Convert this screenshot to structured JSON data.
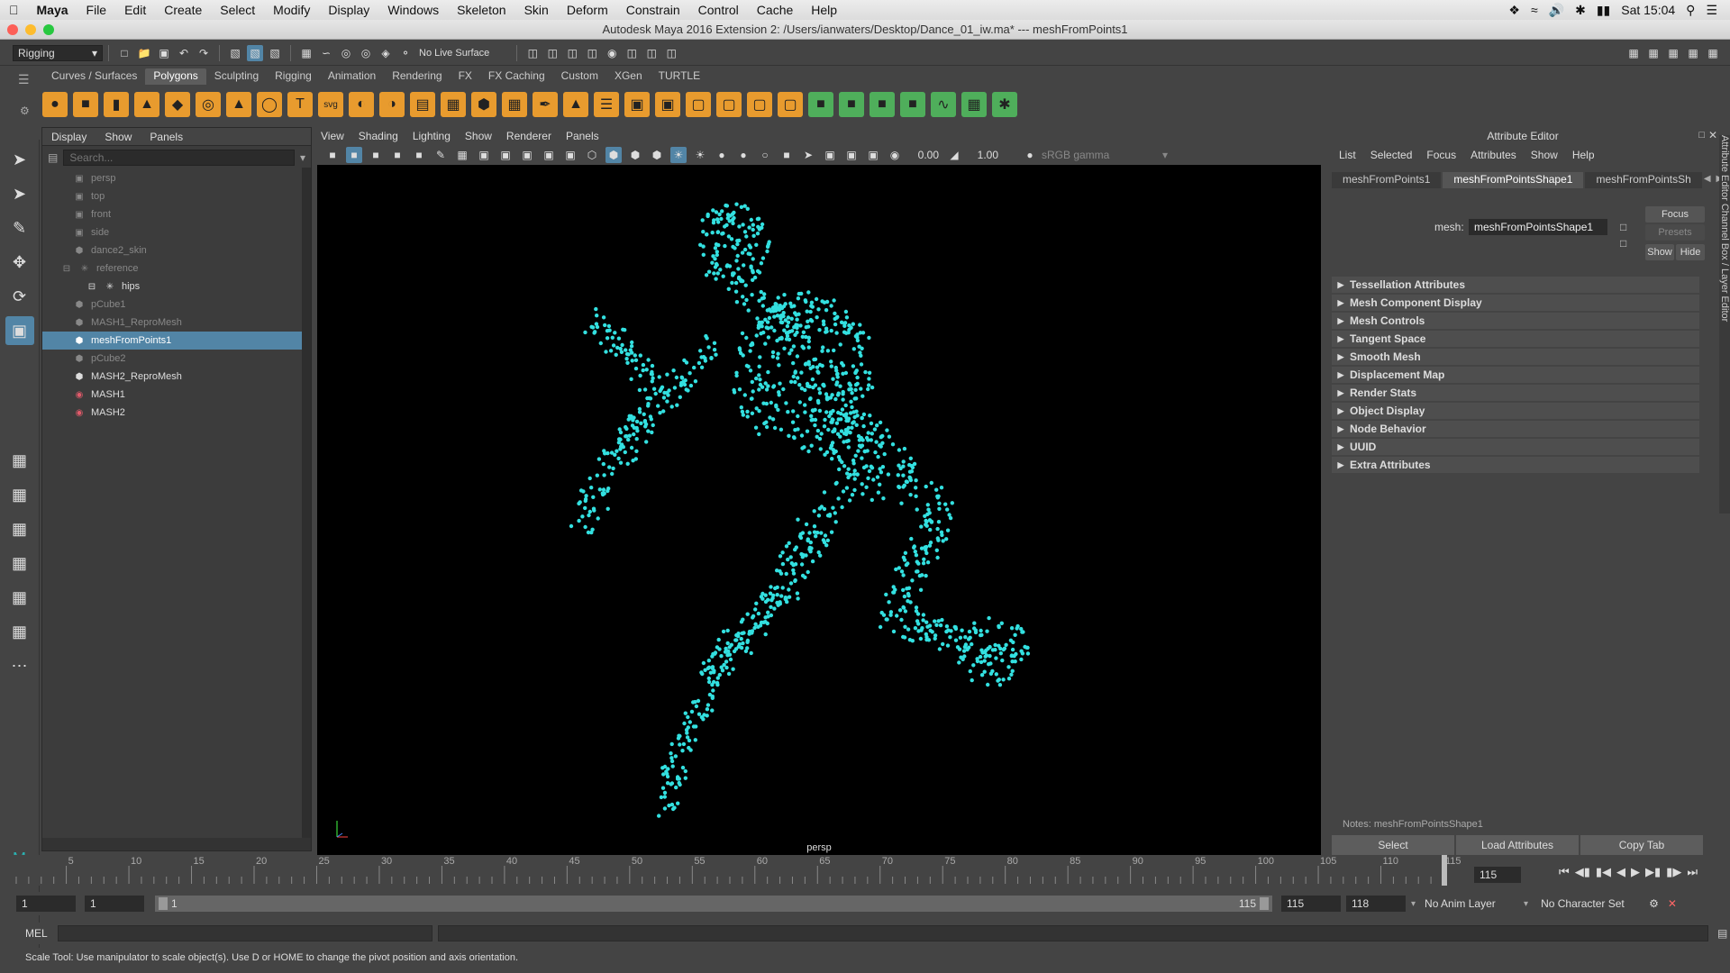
{
  "mac_menu": {
    "app_name": "Maya",
    "items": [
      "File",
      "Edit",
      "Create",
      "Select",
      "Modify",
      "Display",
      "Windows",
      "Skeleton",
      "Skin",
      "Deform",
      "Constrain",
      "Control",
      "Cache",
      "Help"
    ],
    "clock": "Sat 15:04"
  },
  "window_title": "Autodesk Maya 2016 Extension 2: /Users/ianwaters/Desktop/Dance_01_iw.ma*   ---   meshFromPoints1",
  "status_line": {
    "menu_set": "Rigging",
    "live_surface": "No Live Surface"
  },
  "shelf": {
    "tabs": [
      "Curves / Surfaces",
      "Polygons",
      "Sculpting",
      "Rigging",
      "Animation",
      "Rendering",
      "FX",
      "FX Caching",
      "Custom",
      "XGen",
      "TURTLE"
    ],
    "active": "Polygons"
  },
  "outliner": {
    "menus": [
      "Display",
      "Show",
      "Panels"
    ],
    "search_placeholder": "Search...",
    "items": [
      {
        "label": "persp",
        "icon": "camera-icon",
        "dim": true,
        "selected": false
      },
      {
        "label": "top",
        "icon": "camera-icon",
        "dim": true,
        "selected": false
      },
      {
        "label": "front",
        "icon": "camera-icon",
        "dim": true,
        "selected": false
      },
      {
        "label": "side",
        "icon": "camera-icon",
        "dim": true,
        "selected": false
      },
      {
        "label": "dance2_skin",
        "icon": "mesh-icon",
        "dim": true,
        "selected": false
      },
      {
        "label": "reference",
        "icon": "joint-icon",
        "dim": true,
        "selected": false
      },
      {
        "label": "hips",
        "icon": "joint-icon",
        "dim": false,
        "selected": false
      },
      {
        "label": "pCube1",
        "icon": "mesh-icon",
        "dim": true,
        "selected": false
      },
      {
        "label": "MASH1_ReproMesh",
        "icon": "mesh-icon",
        "dim": true,
        "selected": false
      },
      {
        "label": "meshFromPoints1",
        "icon": "mesh-icon",
        "dim": false,
        "selected": true
      },
      {
        "label": "pCube2",
        "icon": "mesh-icon",
        "dim": true,
        "selected": false
      },
      {
        "label": "MASH2_ReproMesh",
        "icon": "mesh-icon",
        "dim": false,
        "selected": false
      },
      {
        "label": "MASH1",
        "icon": "mash-icon",
        "dim": false,
        "selected": false
      },
      {
        "label": "MASH2",
        "icon": "mash-icon",
        "dim": false,
        "selected": false
      }
    ]
  },
  "viewport": {
    "menus": [
      "View",
      "Shading",
      "Lighting",
      "Show",
      "Renderer",
      "Panels"
    ],
    "exposure": "0.00",
    "gamma": "1.00",
    "color_space": "sRGB gamma",
    "camera_label": "persp",
    "point_color": "#33e0e0"
  },
  "attribute_editor": {
    "title": "Attribute Editor",
    "menus": [
      "List",
      "Selected",
      "Focus",
      "Attributes",
      "Show",
      "Help"
    ],
    "tabs": [
      "meshFromPoints1",
      "meshFromPointsShape1",
      "meshFromPointsSh"
    ],
    "active_tab": "meshFromPointsShape1",
    "mesh_label": "mesh:",
    "mesh_value": "meshFromPointsShape1",
    "focus_label": "Focus",
    "presets_label": "Presets",
    "show_label": "Show",
    "hide_label": "Hide",
    "sections": [
      "Tessellation Attributes",
      "Mesh Component Display",
      "Mesh Controls",
      "Tangent Space",
      "Smooth Mesh",
      "Displacement Map",
      "Render Stats",
      "Object Display",
      "Node Behavior",
      "UUID",
      "Extra Attributes"
    ],
    "notes": "Notes:  meshFromPointsShape1",
    "buttons": [
      "Select",
      "Load Attributes",
      "Copy Tab"
    ],
    "side_tabs": "Attribute Editor   Channel Box / Layer Editor"
  },
  "timeline": {
    "ticks": [
      "5",
      "10",
      "15",
      "20",
      "25",
      "30",
      "35",
      "40",
      "45",
      "50",
      "55",
      "60",
      "65",
      "70",
      "75",
      "80",
      "85",
      "90",
      "95",
      "100",
      "105",
      "110",
      "115"
    ],
    "current_frame": "115"
  },
  "range": {
    "start": "1",
    "anim_start": "1",
    "slider_left": "1",
    "slider_right": "115",
    "anim_end": "115",
    "end": "118",
    "anim_layer": "No Anim Layer",
    "character_set": "No Character Set"
  },
  "command_line": {
    "label": "MEL"
  },
  "help_line": "Scale Tool: Use manipulator to scale object(s). Use D or HOME to change the pivot position and axis orientation."
}
